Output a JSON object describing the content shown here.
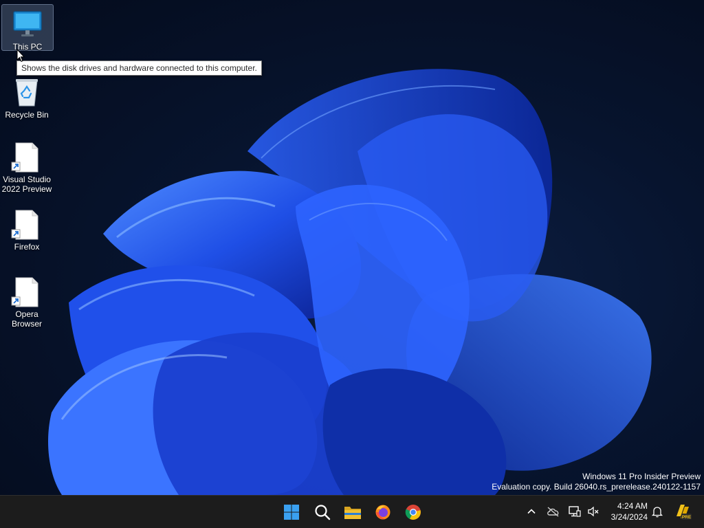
{
  "desktop": {
    "icons": [
      {
        "label": "This PC",
        "icon": "monitor-icon"
      },
      {
        "label": "Recycle Bin",
        "icon": "recycle-bin-icon"
      },
      {
        "label": "Visual Studio 2022 Preview",
        "icon": "shortcut-file-icon"
      },
      {
        "label": "Firefox",
        "icon": "shortcut-file-icon"
      },
      {
        "label": "Opera Browser",
        "icon": "shortcut-file-icon"
      }
    ],
    "tooltip": "Shows the disk drives and hardware connected to this computer.",
    "watermark": {
      "line1": "Windows 11 Pro Insider Preview",
      "line2": "Evaluation copy. Build 26040.rs_prerelease.240122-1157"
    }
  },
  "taskbar": {
    "apps": [
      "start-icon",
      "search-icon",
      "file-explorer-icon",
      "firefox-icon",
      "chrome-icon"
    ],
    "tray": [
      "chevron-up-icon",
      "cloud-offline-icon",
      "network-icon",
      "volume-muted-icon"
    ],
    "clock": {
      "time": "4:24 AM",
      "date": "3/24/2024"
    },
    "badge": "PRE"
  },
  "colors": {
    "taskbar_bg": "#1c1c1c",
    "start_blue": "#3aa0f0",
    "folder_yellow": "#f0c030"
  }
}
